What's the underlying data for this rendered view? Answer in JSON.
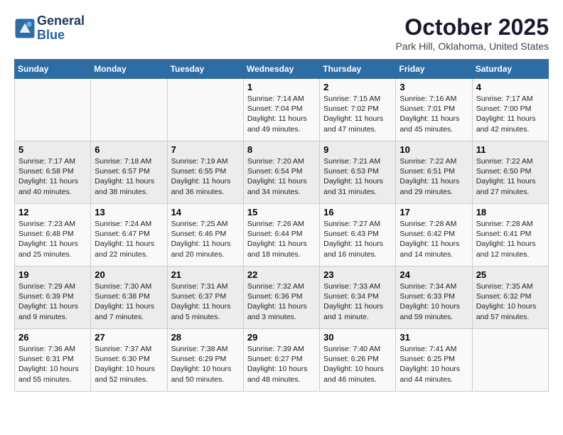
{
  "header": {
    "logo_line1": "General",
    "logo_line2": "Blue",
    "month": "October 2025",
    "location": "Park Hill, Oklahoma, United States"
  },
  "days_of_week": [
    "Sunday",
    "Monday",
    "Tuesday",
    "Wednesday",
    "Thursday",
    "Friday",
    "Saturday"
  ],
  "weeks": [
    [
      {
        "day": "",
        "info": ""
      },
      {
        "day": "",
        "info": ""
      },
      {
        "day": "",
        "info": ""
      },
      {
        "day": "1",
        "info": "Sunrise: 7:14 AM\nSunset: 7:04 PM\nDaylight: 11 hours\nand 49 minutes."
      },
      {
        "day": "2",
        "info": "Sunrise: 7:15 AM\nSunset: 7:02 PM\nDaylight: 11 hours\nand 47 minutes."
      },
      {
        "day": "3",
        "info": "Sunrise: 7:16 AM\nSunset: 7:01 PM\nDaylight: 11 hours\nand 45 minutes."
      },
      {
        "day": "4",
        "info": "Sunrise: 7:17 AM\nSunset: 7:00 PM\nDaylight: 11 hours\nand 42 minutes."
      }
    ],
    [
      {
        "day": "5",
        "info": "Sunrise: 7:17 AM\nSunset: 6:58 PM\nDaylight: 11 hours\nand 40 minutes."
      },
      {
        "day": "6",
        "info": "Sunrise: 7:18 AM\nSunset: 6:57 PM\nDaylight: 11 hours\nand 38 minutes."
      },
      {
        "day": "7",
        "info": "Sunrise: 7:19 AM\nSunset: 6:55 PM\nDaylight: 11 hours\nand 36 minutes."
      },
      {
        "day": "8",
        "info": "Sunrise: 7:20 AM\nSunset: 6:54 PM\nDaylight: 11 hours\nand 34 minutes."
      },
      {
        "day": "9",
        "info": "Sunrise: 7:21 AM\nSunset: 6:53 PM\nDaylight: 11 hours\nand 31 minutes."
      },
      {
        "day": "10",
        "info": "Sunrise: 7:22 AM\nSunset: 6:51 PM\nDaylight: 11 hours\nand 29 minutes."
      },
      {
        "day": "11",
        "info": "Sunrise: 7:22 AM\nSunset: 6:50 PM\nDaylight: 11 hours\nand 27 minutes."
      }
    ],
    [
      {
        "day": "12",
        "info": "Sunrise: 7:23 AM\nSunset: 6:48 PM\nDaylight: 11 hours\nand 25 minutes."
      },
      {
        "day": "13",
        "info": "Sunrise: 7:24 AM\nSunset: 6:47 PM\nDaylight: 11 hours\nand 22 minutes."
      },
      {
        "day": "14",
        "info": "Sunrise: 7:25 AM\nSunset: 6:46 PM\nDaylight: 11 hours\nand 20 minutes."
      },
      {
        "day": "15",
        "info": "Sunrise: 7:26 AM\nSunset: 6:44 PM\nDaylight: 11 hours\nand 18 minutes."
      },
      {
        "day": "16",
        "info": "Sunrise: 7:27 AM\nSunset: 6:43 PM\nDaylight: 11 hours\nand 16 minutes."
      },
      {
        "day": "17",
        "info": "Sunrise: 7:28 AM\nSunset: 6:42 PM\nDaylight: 11 hours\nand 14 minutes."
      },
      {
        "day": "18",
        "info": "Sunrise: 7:28 AM\nSunset: 6:41 PM\nDaylight: 11 hours\nand 12 minutes."
      }
    ],
    [
      {
        "day": "19",
        "info": "Sunrise: 7:29 AM\nSunset: 6:39 PM\nDaylight: 11 hours\nand 9 minutes."
      },
      {
        "day": "20",
        "info": "Sunrise: 7:30 AM\nSunset: 6:38 PM\nDaylight: 11 hours\nand 7 minutes."
      },
      {
        "day": "21",
        "info": "Sunrise: 7:31 AM\nSunset: 6:37 PM\nDaylight: 11 hours\nand 5 minutes."
      },
      {
        "day": "22",
        "info": "Sunrise: 7:32 AM\nSunset: 6:36 PM\nDaylight: 11 hours\nand 3 minutes."
      },
      {
        "day": "23",
        "info": "Sunrise: 7:33 AM\nSunset: 6:34 PM\nDaylight: 11 hours\nand 1 minute."
      },
      {
        "day": "24",
        "info": "Sunrise: 7:34 AM\nSunset: 6:33 PM\nDaylight: 10 hours\nand 59 minutes."
      },
      {
        "day": "25",
        "info": "Sunrise: 7:35 AM\nSunset: 6:32 PM\nDaylight: 10 hours\nand 57 minutes."
      }
    ],
    [
      {
        "day": "26",
        "info": "Sunrise: 7:36 AM\nSunset: 6:31 PM\nDaylight: 10 hours\nand 55 minutes."
      },
      {
        "day": "27",
        "info": "Sunrise: 7:37 AM\nSunset: 6:30 PM\nDaylight: 10 hours\nand 52 minutes."
      },
      {
        "day": "28",
        "info": "Sunrise: 7:38 AM\nSunset: 6:29 PM\nDaylight: 10 hours\nand 50 minutes."
      },
      {
        "day": "29",
        "info": "Sunrise: 7:39 AM\nSunset: 6:27 PM\nDaylight: 10 hours\nand 48 minutes."
      },
      {
        "day": "30",
        "info": "Sunrise: 7:40 AM\nSunset: 6:26 PM\nDaylight: 10 hours\nand 46 minutes."
      },
      {
        "day": "31",
        "info": "Sunrise: 7:41 AM\nSunset: 6:25 PM\nDaylight: 10 hours\nand 44 minutes."
      },
      {
        "day": "",
        "info": ""
      }
    ]
  ]
}
